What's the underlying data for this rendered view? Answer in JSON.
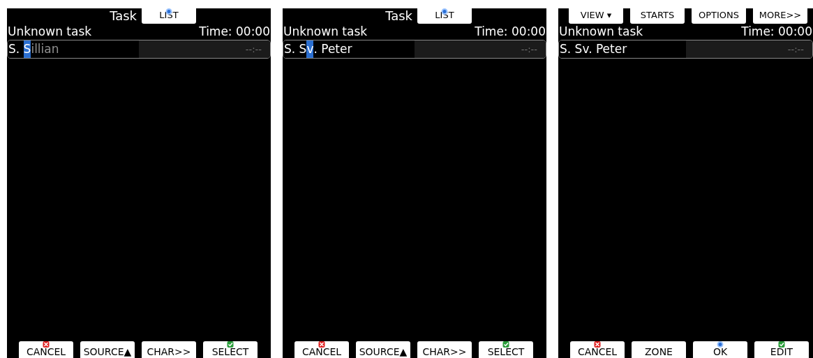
{
  "panels": [
    {
      "title": "Task",
      "top_buttons": [
        {
          "label": "LIST",
          "kind": "dot"
        }
      ],
      "task_name": "Unknown task",
      "time": "Time: 00:00",
      "row": {
        "segments": [
          {
            "text": "S. ",
            "kind": "normal"
          },
          {
            "text": "S",
            "kind": "cursor"
          },
          {
            "text": "illian",
            "kind": "hint"
          }
        ],
        "eta": "--:--"
      },
      "bottom_buttons": [
        {
          "label": "CANCEL",
          "kind": "cross"
        },
        {
          "label": "SOURCE▲",
          "kind": "plain"
        },
        {
          "label": "CHAR>>",
          "kind": "plain"
        },
        {
          "label": "SELECT",
          "kind": "check"
        }
      ]
    },
    {
      "title": "Task",
      "top_buttons": [
        {
          "label": "LIST",
          "kind": "dot"
        }
      ],
      "task_name": "Unknown task",
      "time": "Time: 00:00",
      "row": {
        "segments": [
          {
            "text": "S. S",
            "kind": "normal"
          },
          {
            "text": "v",
            "kind": "cursor"
          },
          {
            "text": ". Peter",
            "kind": "normal"
          }
        ],
        "eta": "--:--"
      },
      "bottom_buttons": [
        {
          "label": "CANCEL",
          "kind": "cross"
        },
        {
          "label": "SOURCE▲",
          "kind": "plain"
        },
        {
          "label": "CHAR>>",
          "kind": "plain"
        },
        {
          "label": "SELECT",
          "kind": "check"
        }
      ]
    },
    {
      "top_buttons": [
        {
          "label": "VIEW ▾",
          "kind": "plain"
        },
        {
          "label": "STARTS",
          "kind": "plain"
        },
        {
          "label": "OPTIONS",
          "kind": "plain"
        },
        {
          "label": "MORE>>",
          "kind": "plain"
        }
      ],
      "task_name": "Unknown task",
      "time": "Time: 00:00",
      "row": {
        "segments": [
          {
            "text": "S. Sv. Peter",
            "kind": "normal"
          }
        ],
        "eta": "--:--"
      },
      "bottom_buttons": [
        {
          "label": "CANCEL",
          "kind": "cross"
        },
        {
          "label": "ZONE",
          "kind": "plain"
        },
        {
          "label": "OK",
          "kind": "dot"
        },
        {
          "label": "EDIT",
          "kind": "check"
        }
      ]
    }
  ]
}
